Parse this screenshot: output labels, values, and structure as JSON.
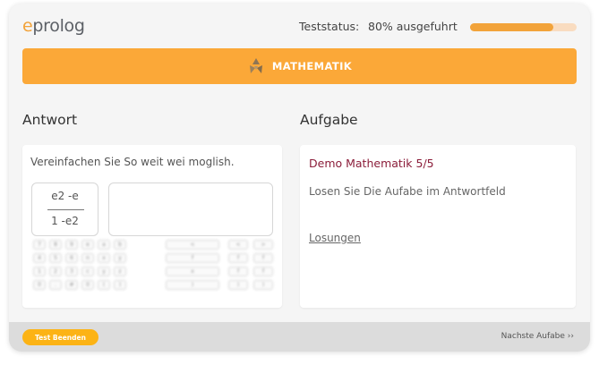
{
  "header": {
    "logo_accent": "e",
    "logo_rest": "prolog",
    "status_label": "Teststatus:",
    "status_value": "80% ausgefuhrt",
    "progress_fraction": 0.78
  },
  "banner": {
    "title": "MATHEMATIK",
    "icon": "triangles-logo-icon"
  },
  "answer": {
    "section_title": "Antwort",
    "question": "Vereinfachen Sie So weit wei moglish.",
    "numerator": "e2 -e",
    "denominator": "1 -e2",
    "input_value": ""
  },
  "keypad": {
    "rows": [
      [
        "7",
        "8",
        "9",
        "e",
        "a",
        "b"
      ],
      [
        "4",
        "5",
        "6",
        "n",
        "x",
        "y"
      ],
      [
        "1",
        "2",
        "3",
        "c",
        "y",
        "z"
      ],
      [
        "0",
        ".",
        "#",
        "0",
        "(",
        ")"
      ]
    ],
    "middle": [
      "<",
      "f",
      "x",
      ")"
    ],
    "right": [
      [
        "<",
        ">"
      ],
      [
        "f",
        "f"
      ],
      [
        "f",
        "f"
      ],
      [
        ")",
        ")"
      ]
    ]
  },
  "task": {
    "section_title": "Aufgabe",
    "title": "Demo Mathematik 5/5",
    "description": "Losen Sie Die Aufabe im Antwortfeld",
    "link": "Losungen"
  },
  "footer": {
    "end_button": "Test Beenden",
    "next_button": "Nachste Aufabe ››"
  },
  "colors": {
    "accent": "#fba838",
    "progress_fill": "#f2a33a",
    "progress_track": "#f9dcc0",
    "task_title": "#8b1d3a",
    "end_button": "#fcb315"
  }
}
